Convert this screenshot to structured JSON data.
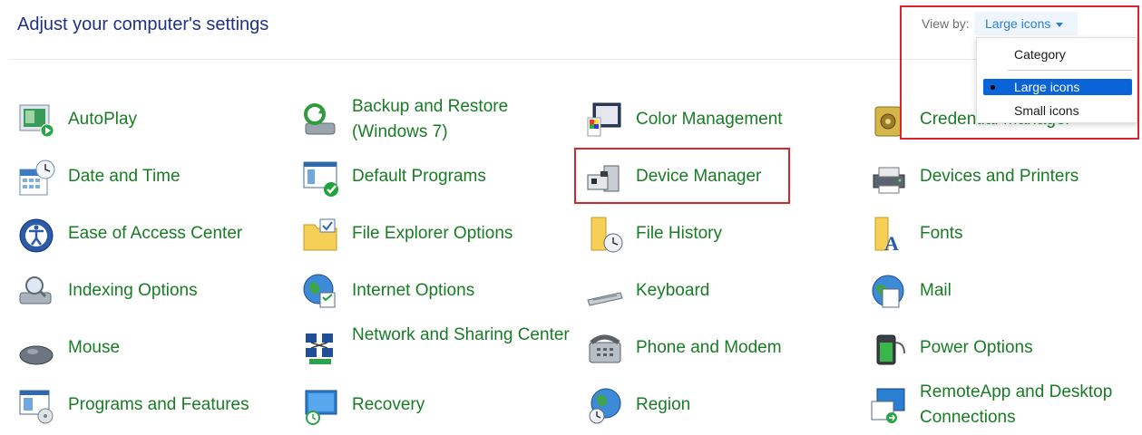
{
  "header": {
    "title": "Adjust your computer's settings",
    "view_by_label": "View by:",
    "view_by_value": "Large icons"
  },
  "dropdown": {
    "options": [
      "Category",
      "Large icons",
      "Small icons"
    ],
    "selected": "Large icons"
  },
  "colors": {
    "title": "#1e3287",
    "item_link": "#187c25",
    "dropdown_accent": "#2a7fd4",
    "menu_selected": "#0a64d8",
    "highlight_box": "#d8242c"
  },
  "items": [
    {
      "label": "AutoPlay",
      "icon": "autoplay-icon"
    },
    {
      "label": "Backup and Restore (Windows 7)",
      "icon": "backup-icon"
    },
    {
      "label": "Color Management",
      "icon": "color-management-icon"
    },
    {
      "label": "Credential Manager",
      "icon": "credential-icon"
    },
    {
      "label": "Date and Time",
      "icon": "calendar-clock-icon"
    },
    {
      "label": "Default Programs",
      "icon": "default-programs-icon"
    },
    {
      "label": "Device Manager",
      "icon": "device-manager-icon"
    },
    {
      "label": "Devices and Printers",
      "icon": "printer-icon"
    },
    {
      "label": "Ease of Access Center",
      "icon": "ease-of-access-icon"
    },
    {
      "label": "File Explorer Options",
      "icon": "folder-options-icon"
    },
    {
      "label": "File History",
      "icon": "file-history-icon"
    },
    {
      "label": "Fonts",
      "icon": "fonts-icon"
    },
    {
      "label": "Indexing Options",
      "icon": "indexing-icon"
    },
    {
      "label": "Internet Options",
      "icon": "globe-icon"
    },
    {
      "label": "Keyboard",
      "icon": "keyboard-icon"
    },
    {
      "label": "Mail",
      "icon": "mail-icon"
    },
    {
      "label": "Mouse",
      "icon": "mouse-icon"
    },
    {
      "label": "Network and Sharing Center",
      "icon": "network-icon"
    },
    {
      "label": "Phone and Modem",
      "icon": "phone-icon"
    },
    {
      "label": "Power Options",
      "icon": "battery-icon"
    },
    {
      "label": "Programs and Features",
      "icon": "programs-icon"
    },
    {
      "label": "Recovery",
      "icon": "recovery-icon"
    },
    {
      "label": "Region",
      "icon": "region-globe-icon"
    },
    {
      "label": "RemoteApp and Desktop Connections",
      "icon": "remote-desktop-icon"
    }
  ]
}
